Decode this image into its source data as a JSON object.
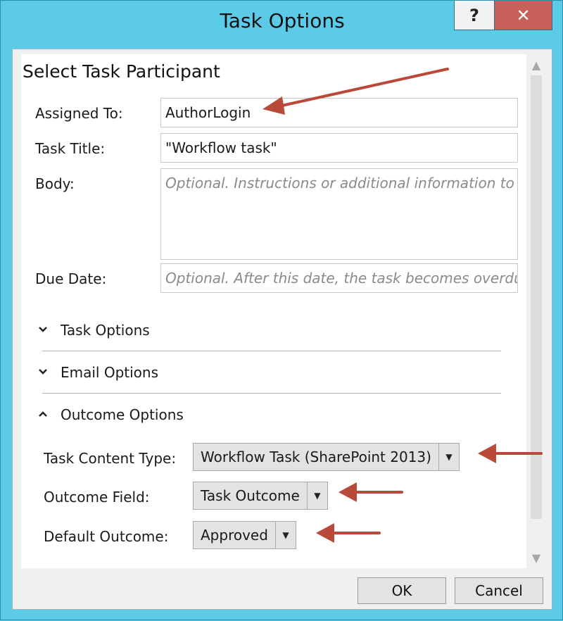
{
  "window": {
    "title": "Task Options",
    "help_label": "?",
    "close_label": "✕"
  },
  "section": {
    "title": "Select Task Participant"
  },
  "fields": {
    "assigned_to": {
      "label": "Assigned To:",
      "value": "AuthorLogin"
    },
    "task_title": {
      "label": "Task Title:",
      "value": "\"Workflow task\""
    },
    "body": {
      "label": "Body:",
      "placeholder": "Optional. Instructions or additional information to"
    },
    "due_date": {
      "label": "Due Date:",
      "placeholder": "Optional. After this date, the task becomes overdu"
    }
  },
  "groups": [
    {
      "label": "Task Options",
      "expanded": false,
      "icon": "chevron-down"
    },
    {
      "label": "Email Options",
      "expanded": false,
      "icon": "chevron-down"
    },
    {
      "label": "Outcome Options",
      "expanded": true,
      "icon": "chevron-up"
    }
  ],
  "outcome": {
    "content_type": {
      "label": "Task Content Type:",
      "value": "Workflow Task (SharePoint 2013)"
    },
    "outcome_field": {
      "label": "Outcome Field:",
      "value": "Task Outcome"
    },
    "default_outcome": {
      "label": "Default Outcome:",
      "value": "Approved"
    }
  },
  "buttons": {
    "ok": "OK",
    "cancel": "Cancel"
  },
  "colors": {
    "titlebar": "#5ccbe8",
    "close_button": "#c95f5a",
    "annotation_arrow": "#b94a3a"
  }
}
